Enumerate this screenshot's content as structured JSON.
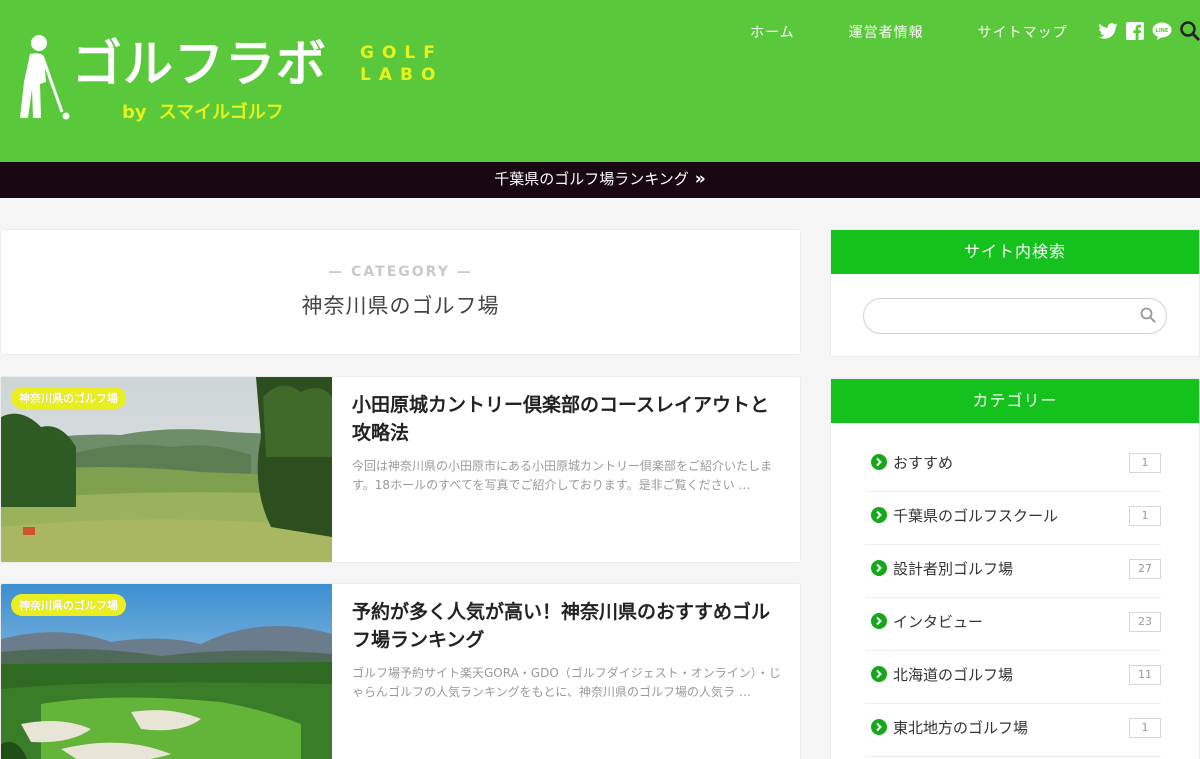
{
  "header": {
    "logo_main": "ゴルフラボ",
    "logo_en_line1": "GOLF",
    "logo_en_line2": "LABO",
    "logo_by": "by",
    "logo_brand": "スマイルゴルフ",
    "nav": [
      "ホーム",
      "運営者情報",
      "サイトマップ"
    ],
    "social_icons": [
      "twitter-icon",
      "facebook-icon",
      "line-icon",
      "search-icon"
    ],
    "brand_color": "#5ac83b",
    "accent_color": "#e6f21c"
  },
  "ticker": {
    "text": "千葉県のゴルフ場ランキング",
    "chevron": "»"
  },
  "category_header": {
    "label": "— CATEGORY —",
    "title": "神奈川県のゴルフ場"
  },
  "articles": [
    {
      "tag": "神奈川県のゴルフ場",
      "title": "小田原城カントリー倶楽部のコースレイアウトと攻略法",
      "excerpt": "今回は神奈川県の小田原市にある小田原城カントリー倶楽部をご紹介いたします。18ホールのすべてを写真でご紹介しております。是非ご覧ください …"
    },
    {
      "tag": "神奈川県のゴルフ場",
      "title": "予約が多く人気が高い！神奈川県のおすすめゴルフ場ランキング",
      "excerpt": "ゴルフ場予約サイト楽天GORA・GDO（ゴルフダイジェスト・オンライン）・じゃらんゴルフの人気ランキングをもとに、神奈川県のゴルフ場の人気ラ …"
    }
  ],
  "sidebar": {
    "search": {
      "title": "サイト内検索",
      "placeholder": ""
    },
    "categories": {
      "title": "カテゴリー",
      "items": [
        {
          "label": "おすすめ",
          "count": "1"
        },
        {
          "label": "千葉県のゴルフスクール",
          "count": "1"
        },
        {
          "label": "設計者別ゴルフ場",
          "count": "27"
        },
        {
          "label": "インタビュー",
          "count": "23"
        },
        {
          "label": "北海道のゴルフ場",
          "count": "11"
        },
        {
          "label": "東北地方のゴルフ場",
          "count": "1"
        }
      ]
    },
    "widget_head_color": "#15c11c"
  }
}
